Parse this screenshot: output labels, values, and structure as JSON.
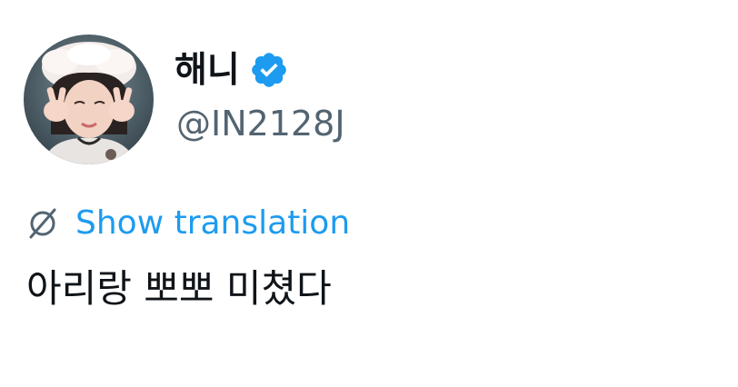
{
  "author": {
    "display_name": "해니",
    "handle": "@IN2128J",
    "verified": true,
    "verified_icon": "verified-badge-icon",
    "avatar_icon": "profile-photo"
  },
  "translation": {
    "label": "Show translation",
    "icon": "globe-slash-icon"
  },
  "tweet": {
    "text": "아리랑 뽀뽀 미쳤다"
  },
  "colors": {
    "text_primary": "#0f1419",
    "text_secondary": "#536471",
    "accent": "#1d9bf0",
    "background": "#ffffff"
  }
}
